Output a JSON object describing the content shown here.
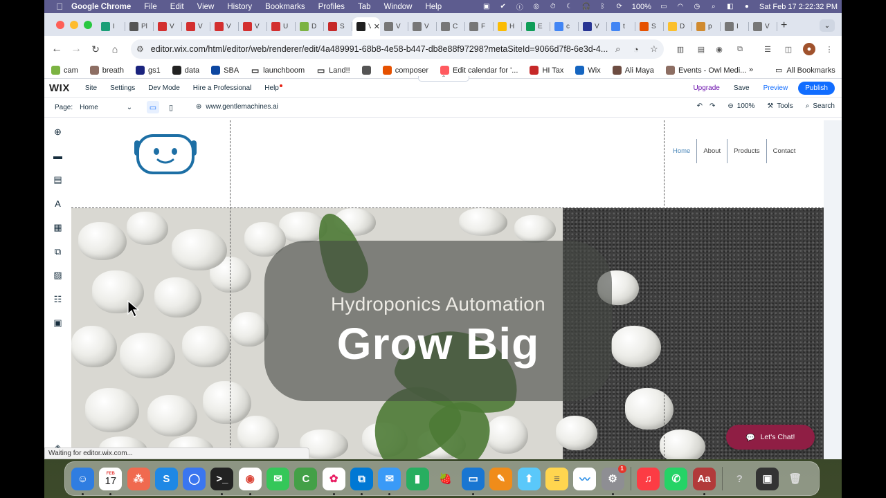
{
  "menubar": {
    "app": "Google Chrome",
    "items": [
      "File",
      "Edit",
      "View",
      "History",
      "Bookmarks",
      "Profiles",
      "Tab",
      "Window",
      "Help"
    ],
    "battery": "100%",
    "datetime": "Sat Feb 17  2:22:32 PM"
  },
  "tabs": [
    {
      "label": "I",
      "color": "#1b9e77",
      "icon": "openai-icon"
    },
    {
      "label": "Pl",
      "color": "#555",
      "icon": "pl-icon"
    },
    {
      "label": "V",
      "color": "#d32f2f",
      "icon": "youtube-studio-icon"
    },
    {
      "label": "V",
      "color": "#d32f2f",
      "icon": "youtube-studio-icon"
    },
    {
      "label": "V",
      "color": "#d32f2f",
      "icon": "youtube-studio-icon"
    },
    {
      "label": "V",
      "color": "#d32f2f",
      "icon": "youtube-studio-icon"
    },
    {
      "label": "U",
      "color": "#d32f2f",
      "icon": "youtube-studio-icon"
    },
    {
      "label": "D",
      "color": "#7cb342",
      "icon": "node-icon"
    },
    {
      "label": "S",
      "color": "#c62828",
      "icon": "bank-icon"
    },
    {
      "label": "V",
      "color": "#1f1f1f",
      "icon": "wix-icon",
      "active": true
    },
    {
      "label": "V",
      "color": "#777",
      "icon": "globe-icon"
    },
    {
      "label": "V",
      "color": "#777",
      "icon": "globe-icon"
    },
    {
      "label": "C",
      "color": "#777",
      "icon": "globe-icon"
    },
    {
      "label": "F",
      "color": "#777",
      "icon": "globe-icon"
    },
    {
      "label": "H",
      "color": "#fbbc04",
      "icon": "drive-icon"
    },
    {
      "label": "E",
      "color": "#0f9d58",
      "icon": "sheets-icon"
    },
    {
      "label": "c",
      "color": "#4285f4",
      "icon": "google-icon"
    },
    {
      "label": "V",
      "color": "#283593",
      "icon": "shield-icon"
    },
    {
      "label": "t",
      "color": "#4285f4",
      "icon": "google-icon"
    },
    {
      "label": "S",
      "color": "#e65100",
      "icon": "orange-icon"
    },
    {
      "label": "D",
      "color": "#fbc02d",
      "icon": "calendar-icon"
    },
    {
      "label": "p",
      "color": "#d08a2f",
      "icon": "pyramid-icon"
    },
    {
      "label": "I",
      "color": "#777",
      "icon": "globe-icon"
    },
    {
      "label": "V",
      "color": "#777",
      "icon": "globe-icon"
    }
  ],
  "omnibox": {
    "url": "editor.wix.com/html/editor/web/renderer/edit/4a489991-68b8-4e58-b447-db8e88f97298?metaSiteId=9066d7f8-6e3d-4..."
  },
  "bookmarks": [
    {
      "label": "cam",
      "color": "#7cb342"
    },
    {
      "label": "breath",
      "color": "#8d6e63"
    },
    {
      "label": "gs1",
      "color": "#1a237e"
    },
    {
      "label": "data",
      "color": "#222"
    },
    {
      "label": "SBA",
      "color": "#0d47a1"
    },
    {
      "label": "launchboom",
      "color": "folder"
    },
    {
      "label": "Land!!",
      "color": "folder"
    },
    {
      "label": "",
      "color": "#555"
    },
    {
      "label": "composer",
      "color": "#e65100"
    },
    {
      "label": "Edit calendar for '...",
      "color": "#ff5a5f"
    },
    {
      "label": "HI Tax",
      "color": "#c62828"
    },
    {
      "label": "Wix",
      "color": "#1565c0"
    },
    {
      "label": "Ali Maya",
      "color": "#6d4c41"
    },
    {
      "label": "Events - Owl Medi...",
      "color": "#8d6e63"
    }
  ],
  "bookmarks_all": "All Bookmarks",
  "wix": {
    "logo": "WIX",
    "menu": [
      "Site",
      "Settings",
      "Dev Mode",
      "Hire a Professional",
      "Help"
    ],
    "upgrade": "Upgrade",
    "save": "Save",
    "preview": "Preview",
    "publish": "Publish",
    "page_label": "Page:",
    "page_value": "Home",
    "domain": "www.gentlemachines.ai",
    "zoom": "100%",
    "tools": "Tools",
    "search": "Search"
  },
  "site": {
    "nav": [
      "Home",
      "About",
      "Products",
      "Contact"
    ],
    "hero_subtitle": "Hydroponics Automation",
    "hero_title": "Grow Big",
    "chat_label": "Let's Chat!"
  },
  "status": "Waiting for editor.wix.com...",
  "dock": [
    {
      "name": "finder-icon",
      "color": "#2f7de1",
      "glyph": "☺"
    },
    {
      "name": "calendar-icon",
      "color": "#ffffff",
      "glyph": "17",
      "text": "#222",
      "month": "FEB"
    },
    {
      "name": "asana-icon",
      "color": "#f06a4f",
      "glyph": "⁂"
    },
    {
      "name": "skype-icon",
      "color": "#1e88e5",
      "glyph": "S"
    },
    {
      "name": "signal-icon",
      "color": "#3a76f0",
      "glyph": "◯"
    },
    {
      "name": "terminal-icon",
      "color": "#222",
      "glyph": ">_"
    },
    {
      "name": "chrome-icon",
      "color": "#ffffff",
      "glyph": "◉",
      "text": "#db4437"
    },
    {
      "name": "messages-icon",
      "color": "#34c759",
      "glyph": "✉"
    },
    {
      "name": "cursor-app-icon",
      "color": "#43a047",
      "glyph": "C"
    },
    {
      "name": "photos-icon",
      "color": "#ffffff",
      "glyph": "✿",
      "text": "#e91e63"
    },
    {
      "name": "vscode-icon",
      "color": "#0078d4",
      "glyph": "⧉"
    },
    {
      "name": "mail-icon",
      "color": "#3a9af7",
      "glyph": "✉"
    },
    {
      "name": "numbers-icon",
      "color": "#27ae60",
      "glyph": "▮"
    },
    {
      "name": "raspberry-pi-icon",
      "color": "transparent",
      "glyph": "🍓",
      "text": "#c2185b"
    },
    {
      "name": "keynote-icon",
      "color": "#1976d2",
      "glyph": "▭"
    },
    {
      "name": "pages-icon",
      "color": "#f08c1a",
      "glyph": "✎"
    },
    {
      "name": "maps-icon",
      "color": "#5ac8fa",
      "glyph": "⬆"
    },
    {
      "name": "notes-icon",
      "color": "#ffd54f",
      "glyph": "≡",
      "text": "#555"
    },
    {
      "name": "freeform-icon",
      "color": "#ffffff",
      "glyph": "〰",
      "text": "#1e88e5"
    },
    {
      "name": "system-settings-icon",
      "color": "#8e8e93",
      "glyph": "⚙",
      "badge": "1"
    },
    {
      "name": "music-icon",
      "color": "#fc3c44",
      "glyph": "♫"
    },
    {
      "name": "whatsapp-icon",
      "color": "#25d366",
      "glyph": "✆"
    },
    {
      "name": "dictionary-icon",
      "color": "#b23a3a",
      "glyph": "Aa"
    },
    {
      "name": "help-icon",
      "color": "transparent",
      "glyph": "?",
      "text": "#ccc"
    },
    {
      "name": "screenshot-folder-icon",
      "color": "#333",
      "glyph": "▣"
    },
    {
      "name": "trash-icon",
      "color": "transparent",
      "glyph": "🗑",
      "text": "#ddd"
    }
  ]
}
